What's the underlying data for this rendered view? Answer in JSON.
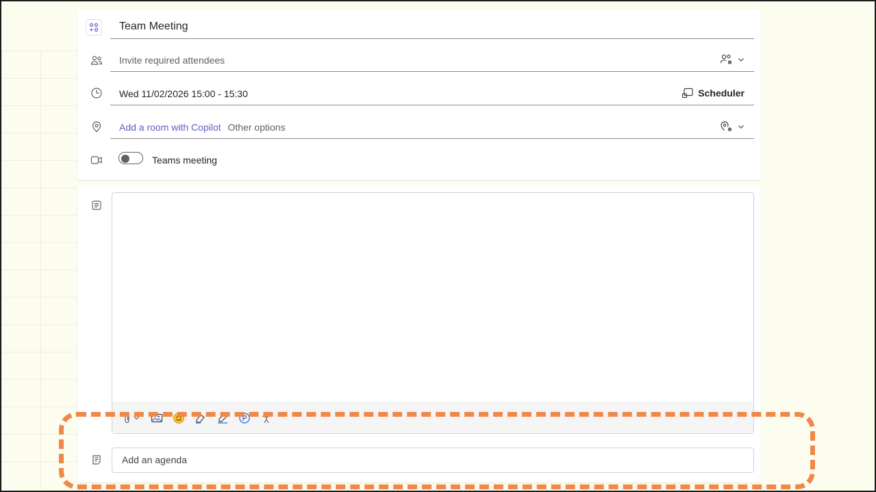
{
  "form": {
    "title": "Team Meeting",
    "attendees_placeholder": "Invite required attendees",
    "datetime": "Wed 11/02/2026 15:00 - 15:30",
    "scheduler_label": "Scheduler",
    "location_link": "Add a room with Copilot",
    "location_other": "Other options",
    "teams_toggle_label": "Teams meeting",
    "teams_toggle_on": false
  },
  "editor": {
    "toolbar_icons": [
      "attach-icon",
      "image-icon",
      "emoji-icon",
      "highlight-icon",
      "signature-icon",
      "loop-icon",
      "accessibility-icon"
    ]
  },
  "agenda": {
    "placeholder": "Add an agenda"
  },
  "colors": {
    "accent": "#5b5fc7",
    "highlight_dash": "#f0884a",
    "background": "#fdfdef"
  }
}
